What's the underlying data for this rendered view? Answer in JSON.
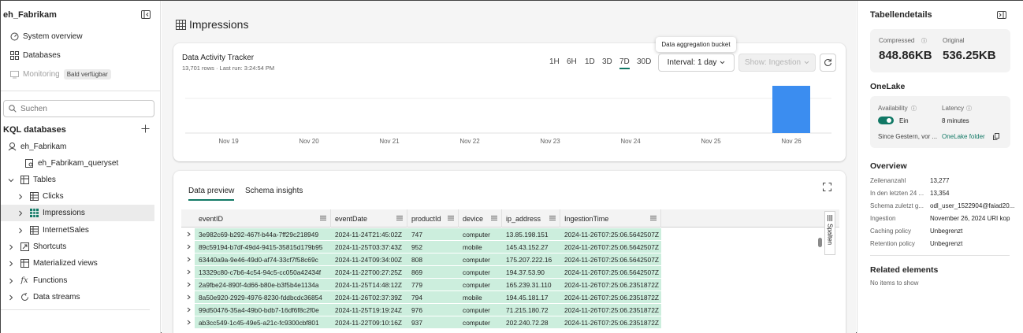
{
  "sidebar": {
    "workspace": "eh_Fabrikam",
    "nav": {
      "overview": "System overview",
      "databases": "Databases",
      "monitoring": "Monitoring",
      "monitoring_badge": "Bald verfügbar"
    },
    "search_placeholder": "Suchen",
    "section_title": "KQL databases",
    "tree": {
      "db": "eh_Fabrikam",
      "queryset": "eh_Fabrikam_queryset",
      "tables": "Tables",
      "clicks": "Clicks",
      "impressions": "Impressions",
      "internetsales": "InternetSales",
      "shortcuts": "Shortcuts",
      "materialized": "Materialized views",
      "functions": "Functions",
      "streams": "Data streams"
    }
  },
  "main": {
    "page_title": "Impressions",
    "tracker": {
      "title": "Data Activity Tracker",
      "subtitle": "13,701 rows · Last run: 3:24:54 PM",
      "ranges": [
        "1H",
        "6H",
        "1D",
        "3D",
        "7D",
        "30D"
      ],
      "active_range": "7D",
      "interval_label": "Interval: 1 day",
      "show_label": "Show: Ingestion",
      "tooltip": "Data aggregation bucket"
    },
    "tabs": {
      "preview": "Data preview",
      "schema": "Schema insights"
    },
    "side_tab": "Spalten",
    "grid": {
      "columns": [
        "eventID",
        "eventDate",
        "productId",
        "device",
        "ip_address",
        "IngestionTime"
      ],
      "rows": [
        [
          "3e982c69-b292-467f-b44a-7ff29c218949",
          "2024-11-24T21:45:02Z",
          "747",
          "computer",
          "13.85.198.151",
          "2024-11-26T07:25:06.5642507Z"
        ],
        [
          "89c59194-b7df-49d4-9415-35815d179b95",
          "2024-11-25T03:37:43Z",
          "952",
          "mobile",
          "145.43.152.27",
          "2024-11-26T07:25:06.5642507Z"
        ],
        [
          "63440a9a-9e46-49d0-af74-33cf7f58c69c",
          "2024-11-24T09:34:00Z",
          "808",
          "computer",
          "175.207.222.16",
          "2024-11-26T07:25:06.5642507Z"
        ],
        [
          "13329c80-c7b6-4c54-94c5-cc050a42434f",
          "2024-11-22T00:27:25Z",
          "869",
          "computer",
          "194.37.53.90",
          "2024-11-26T07:25:06.5642507Z"
        ],
        [
          "2a9fbe24-890f-4d66-b80e-b3f5b4e1134a",
          "2024-11-25T14:48:12Z",
          "779",
          "computer",
          "165.239.31.110",
          "2024-11-26T07:25:06.2351872Z"
        ],
        [
          "8a50e920-2929-4976-8230-fddbcdc36854",
          "2024-11-26T02:37:39Z",
          "794",
          "mobile",
          "194.45.181.17",
          "2024-11-26T07:25:06.2351872Z"
        ],
        [
          "99d50476-35a4-49b0-bdb7-16df6f8c2f0e",
          "2024-11-25T19:19:24Z",
          "976",
          "computer",
          "71.215.180.72",
          "2024-11-26T07:25:06.2351872Z"
        ],
        [
          "ab3cc549-1c45-49e5-a21c-fc9300cbf801",
          "2024-11-22T09:10:16Z",
          "937",
          "computer",
          "202.240.72.28",
          "2024-11-26T07:25:06.2351872Z"
        ]
      ]
    }
  },
  "chart_data": {
    "type": "bar",
    "categories": [
      "Nov 19",
      "Nov 20",
      "Nov 21",
      "Nov 22",
      "Nov 23",
      "Nov 24",
      "Nov 25",
      "Nov 26"
    ],
    "values": [
      0,
      0,
      0,
      0,
      0,
      0,
      0,
      13701
    ],
    "title": "",
    "xlabel": "",
    "ylabel": "",
    "bar_color": "#3b8df0",
    "grid": true
  },
  "details": {
    "title": "Tabellendetails",
    "compressed_label": "Compressed",
    "compressed_value": "848.86KB",
    "original_label": "Original",
    "original_value": "536.25KB",
    "onelake_title": "OneLake",
    "availability_label": "Availability",
    "availability_value": "Ein",
    "availability_on": true,
    "latency_label": "Latency",
    "latency_value": "8 minutes",
    "since_text": "Since Gestern, vor ...",
    "onelake_folder": "OneLake folder",
    "overview_title": "Overview",
    "overview": [
      {
        "k": "Zeilenanzahl",
        "v": "13,277"
      },
      {
        "k": "In den letzten 24 ...",
        "v": "13,354"
      },
      {
        "k": "Schema zuletzt g...",
        "v": "odl_user_1522904@faiad20..."
      },
      {
        "k": "Ingestion",
        "v": "November 26, 2024   URI kop"
      },
      {
        "k": "Caching policy",
        "v": "Unbegrenzt"
      },
      {
        "k": "Retention policy",
        "v": "Unbegrenzt"
      }
    ],
    "related_title": "Related elements",
    "related_empty": "No items to show"
  },
  "colors": {
    "accent": "#117865",
    "selection_green": "#cceedd",
    "bar": "#3b8df0"
  }
}
